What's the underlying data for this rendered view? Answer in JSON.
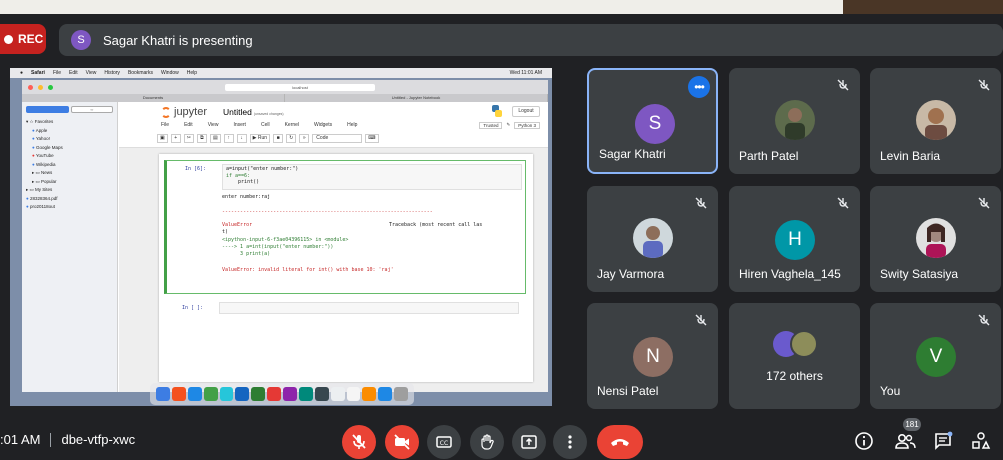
{
  "meet": {
    "rec_label": "REC",
    "presenter_initial": "S",
    "presenting_text": "Sagar Khatri is presenting",
    "time": ":01 AM",
    "meeting_code": "dbe-vtfp-xwc",
    "participant_count": "181"
  },
  "participants": [
    {
      "name": "Sagar Khatri",
      "initial": "S",
      "color": "#7e57c2",
      "active": true
    },
    {
      "name": "Parth Patel",
      "photo": true
    },
    {
      "name": "Levin Baria",
      "photo": true
    },
    {
      "name": "Jay Varmora",
      "photo": true
    },
    {
      "name": "Hiren Vaghela_145",
      "initial": "H",
      "color": "#0097a7"
    },
    {
      "name": "Swity Satasiya",
      "photo": true
    },
    {
      "name": "Nensi Patel",
      "initial": "N",
      "color": "#8d6e63"
    },
    {
      "name": "172 others"
    },
    {
      "name": "You",
      "initial": "V",
      "color": "#2e7d32"
    }
  ],
  "shared": {
    "mac_menu": [
      "Safari",
      "File",
      "Edit",
      "View",
      "History",
      "Bookmarks",
      "Window",
      "Help"
    ],
    "mac_clock": "Wed 11:01 AM",
    "address": "localhost",
    "tabs": [
      "Documents",
      "Untitled - Jupyter Notebook"
    ],
    "sidebar": {
      "favorites": "Favorites",
      "fav_items": [
        "Apple",
        "Yahoo!",
        "Google Maps",
        "YouTube",
        "Wikipedia"
      ],
      "groups": [
        "News",
        "Popular",
        "My Sites"
      ],
      "files": [
        "28328364.pdf",
        "pro20118out"
      ]
    },
    "jupyter": {
      "logo": "jupyter",
      "title": "Untitled",
      "title_note": "(unsaved changes)",
      "logout": "Logout",
      "menu": [
        "File",
        "Edit",
        "View",
        "Insert",
        "Cell",
        "Kernel",
        "Widgets",
        "Help"
      ],
      "trusted": "Trusted",
      "kernel": "Python 3",
      "run_label": "Run",
      "cell_type": "Code",
      "prompt_in": "In [6]:",
      "code_lines": [
        "a=input(\"enter number:\")",
        "if a==6:",
        "    print()"
      ],
      "out_lines": [
        "enter number:raj"
      ],
      "err_rule": "----------------------------------------------------------------------",
      "err_name": "ValueError",
      "traceback": "Traceback (most recent call las",
      "traceback_cont": "t)",
      "tb_line1": "<ipython-input-6-f3ae04396115> in <module>",
      "tb_line2": "----> 1 a=int(input(\"enter number:\"))",
      "tb_line3": "      3 print(a)",
      "err_msg": "ValueError: invalid literal for int() with base 10: 'raj'",
      "prompt_empty": "In [ ]:"
    }
  }
}
